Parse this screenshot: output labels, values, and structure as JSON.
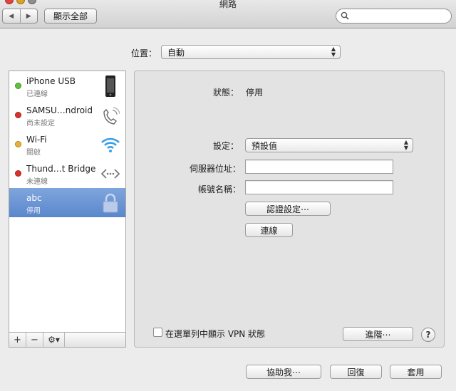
{
  "window": {
    "title": "網路"
  },
  "toolbar": {
    "back_glyph": "◀",
    "forward_glyph": "▶",
    "show_all_label": "顯示全部",
    "search_value": ""
  },
  "location": {
    "label": "位置：",
    "value": "自動"
  },
  "services": [
    {
      "name": "iPhone USB",
      "status": "已連線",
      "dot_color": "#5cc23a",
      "icon": "iphone-icon"
    },
    {
      "name": "SAMSU…ndroid",
      "status": "尚未設定",
      "dot_color": "#d8322a",
      "icon": "phone-handset-icon"
    },
    {
      "name": "Wi-Fi",
      "status": "關啟",
      "dot_color": "#e7b22f",
      "icon": "wifi-icon"
    },
    {
      "name": "Thund…t Bridge",
      "status": "未連線",
      "dot_color": "#d8322a",
      "icon": "thunderbolt-bridge-icon"
    },
    {
      "name": "abc",
      "status": "停用",
      "dot_color": "",
      "icon": "lock-icon",
      "selected": true
    }
  ],
  "sidebar_actions": {
    "add": "+",
    "remove": "−",
    "gear": "⚙▾"
  },
  "detail": {
    "status_label": "狀態：",
    "status_value": "停用",
    "config_label": "設定：",
    "config_value": "預設值",
    "server_label": "伺服器位址：",
    "server_value": "",
    "account_label": "帳號名稱：",
    "account_value": "",
    "auth_button": "認證設定⋯",
    "connect_button": "連線",
    "show_vpn_label": "在選單列中顯示 VPN 狀態",
    "advanced_button": "進階⋯",
    "help_button": "?"
  },
  "footer": {
    "assist_button": "協助我⋯",
    "revert_button": "回復",
    "apply_button": "套用"
  }
}
